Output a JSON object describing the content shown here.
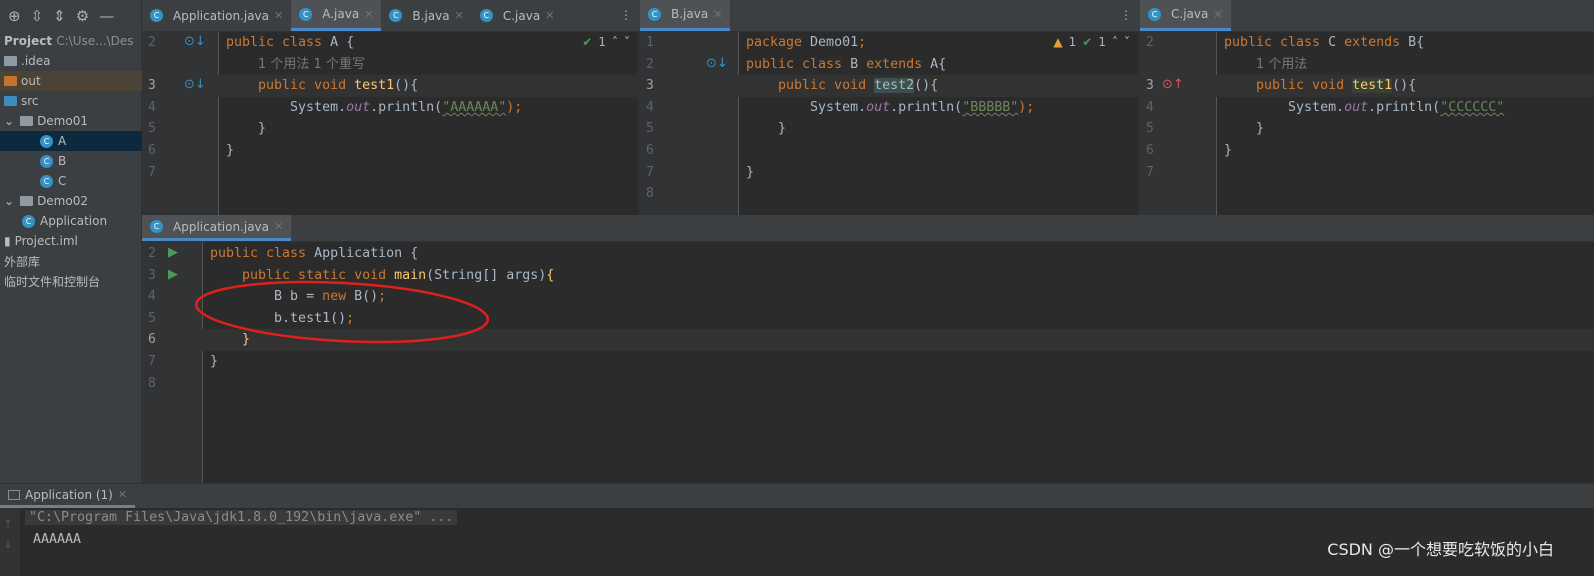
{
  "toolbar": {
    "icons": [
      "crosshair-icon",
      "expand-all-icon",
      "collapse-all-icon",
      "gear-icon",
      "minimize-icon"
    ]
  },
  "project": {
    "title": "Project",
    "path": "C:\\Use...\\Des",
    "items": [
      {
        "label": ".idea",
        "type": "folder"
      },
      {
        "label": "out",
        "type": "folder-orange"
      },
      {
        "label": "src",
        "type": "folder-blue"
      },
      {
        "label": "Demo01",
        "type": "package"
      },
      {
        "label": "A",
        "type": "class"
      },
      {
        "label": "B",
        "type": "class"
      },
      {
        "label": "C",
        "type": "class"
      },
      {
        "label": "Demo02",
        "type": "package"
      },
      {
        "label": "Application",
        "type": "main-class"
      },
      {
        "label": "Project.iml",
        "type": "file"
      },
      {
        "label": "外部库",
        "type": "lib"
      },
      {
        "label": "临时文件和控制台",
        "type": "scratch"
      }
    ]
  },
  "editors": {
    "left": {
      "tabs": [
        "Application.java",
        "A.java",
        "B.java",
        "C.java"
      ],
      "active": 1,
      "inspection": {
        "ok": "1"
      }
    },
    "middle": {
      "tabs": [
        "B.java"
      ],
      "inspection": {
        "warn": "1",
        "ok": "1"
      }
    },
    "right": {
      "tabs": [
        "C.java"
      ]
    },
    "bottom": {
      "tabs": [
        "Application.java"
      ]
    }
  },
  "code": {
    "A": {
      "hint": "1 个用法   1 个重写",
      "lines": [
        {
          "n": "2",
          "tokens": [
            [
              "public class ",
              "kw"
            ],
            [
              "A {",
              "pl"
            ]
          ]
        },
        {
          "n": "3",
          "tokens": [
            [
              "    public void ",
              "kw"
            ],
            [
              "test1",
              "fn"
            ],
            [
              "(){",
              "pl"
            ]
          ]
        },
        {
          "n": "4",
          "tokens": [
            [
              "        System.",
              "pl"
            ],
            [
              "out",
              "st"
            ],
            [
              ".println(",
              "pl"
            ],
            [
              "\"AAAAAA\"",
              "str"
            ],
            [
              ");",
              "kw"
            ]
          ]
        },
        {
          "n": "5",
          "tokens": [
            [
              "    }",
              "pl"
            ]
          ]
        },
        {
          "n": "6",
          "tokens": [
            [
              "}",
              "pl"
            ]
          ]
        },
        {
          "n": "7",
          "tokens": []
        }
      ]
    },
    "B": {
      "lines": [
        {
          "n": "1",
          "tokens": [
            [
              "package ",
              "kw"
            ],
            [
              "Demo01",
              "pl"
            ],
            [
              ";",
              "kw"
            ]
          ]
        },
        {
          "n": "2",
          "tokens": [
            [
              "public class ",
              "kw"
            ],
            [
              "B ",
              "pl"
            ],
            [
              "extends ",
              "kw"
            ],
            [
              "A{",
              "pl"
            ]
          ]
        },
        {
          "n": "3",
          "tokens": [
            [
              "    public void ",
              "kw"
            ],
            [
              "test2",
              "hl2"
            ],
            [
              "(){",
              "pl"
            ]
          ]
        },
        {
          "n": "4",
          "tokens": [
            [
              "        System.",
              "pl"
            ],
            [
              "out",
              "st"
            ],
            [
              ".println(",
              "pl"
            ],
            [
              "\"BBBBB\"",
              "str"
            ],
            [
              ");",
              "kw"
            ]
          ]
        },
        {
          "n": "5",
          "tokens": [
            [
              "    }",
              "pl"
            ]
          ]
        },
        {
          "n": "6",
          "tokens": []
        },
        {
          "n": "7",
          "tokens": [
            [
              "}",
              "pl"
            ]
          ]
        },
        {
          "n": "8",
          "tokens": []
        }
      ]
    },
    "C": {
      "hint": "1 个用法",
      "lines": [
        {
          "n": "2",
          "tokens": [
            [
              "public class ",
              "kw"
            ],
            [
              "C ",
              "pl"
            ],
            [
              "extends ",
              "kw"
            ],
            [
              "B{",
              "pl"
            ]
          ]
        },
        {
          "n": "3",
          "tokens": [
            [
              "    public void ",
              "kw"
            ],
            [
              "test1",
              "fn"
            ],
            [
              "(){",
              "pl"
            ]
          ]
        },
        {
          "n": "4",
          "tokens": [
            [
              "        System.",
              "pl"
            ],
            [
              "out",
              "st"
            ],
            [
              ".println(",
              "pl"
            ],
            [
              "\"CCCCCC\"",
              "str"
            ]
          ]
        },
        {
          "n": "5",
          "tokens": [
            [
              "    }",
              "pl"
            ]
          ]
        },
        {
          "n": "6",
          "tokens": [
            [
              "}",
              "pl"
            ]
          ]
        },
        {
          "n": "7",
          "tokens": []
        }
      ]
    },
    "App": {
      "lines": [
        {
          "n": "2",
          "tokens": [
            [
              "public class ",
              "kw"
            ],
            [
              "Application {",
              "pl"
            ]
          ]
        },
        {
          "n": "3",
          "tokens": [
            [
              "    public static void ",
              "kw"
            ],
            [
              "main",
              "fn"
            ],
            [
              "(String[] args)",
              "pl"
            ],
            [
              "{",
              "fn"
            ]
          ]
        },
        {
          "n": "4",
          "tokens": [
            [
              "        B b = ",
              "pl"
            ],
            [
              "new ",
              "kw"
            ],
            [
              "B()",
              "pl"
            ],
            [
              ";",
              "kw"
            ]
          ]
        },
        {
          "n": "5",
          "tokens": [
            [
              "        b.test1()",
              "pl"
            ],
            [
              ";",
              "kw"
            ]
          ]
        },
        {
          "n": "6",
          "tokens": [
            [
              "    }",
              "fn"
            ]
          ]
        },
        {
          "n": "7",
          "tokens": [
            [
              "}",
              "pl"
            ]
          ]
        },
        {
          "n": "8",
          "tokens": []
        }
      ]
    }
  },
  "run": {
    "tab": "Application (1)",
    "command": "\"C:\\Program Files\\Java\\jdk1.8.0_192\\bin\\java.exe\" ...",
    "output": "AAAAAA"
  },
  "watermark": "CSDN @一个想要吃软饭的小白",
  "colors": {
    "keyword": "#cc7832",
    "string": "#6a8759",
    "method": "#ffc66d",
    "field": "#9876aa",
    "text": "#a9b7c6",
    "annotation": "#e0201b",
    "accent": "#4a88c7"
  }
}
